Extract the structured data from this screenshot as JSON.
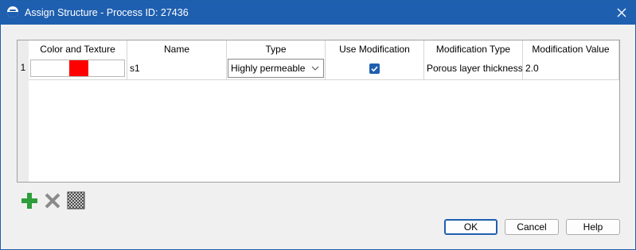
{
  "window": {
    "title": "Assign Structure - Process ID: 27436"
  },
  "grid": {
    "columns": [
      "Color and Texture",
      "Name",
      "Type",
      "Use Modification",
      "Modification Type",
      "Modification Value"
    ],
    "rows": [
      {
        "number": "1",
        "color": "#ff0000",
        "name": "s1",
        "type": "Highly permeable",
        "use_modification": true,
        "modification_type": "Porous layer thickness",
        "modification_value": "2.0"
      }
    ]
  },
  "toolbar": {
    "add_icon": "plus-icon",
    "delete_icon": "x-icon",
    "pattern_icon": "hatch-pattern-icon",
    "add_color": "#2e9e3a",
    "delete_color": "#8a8a8a"
  },
  "buttons": {
    "ok": "OK",
    "cancel": "Cancel",
    "help": "Help"
  },
  "colors": {
    "title_bar": "#1f5fb0",
    "accent": "#1f5fb0"
  }
}
